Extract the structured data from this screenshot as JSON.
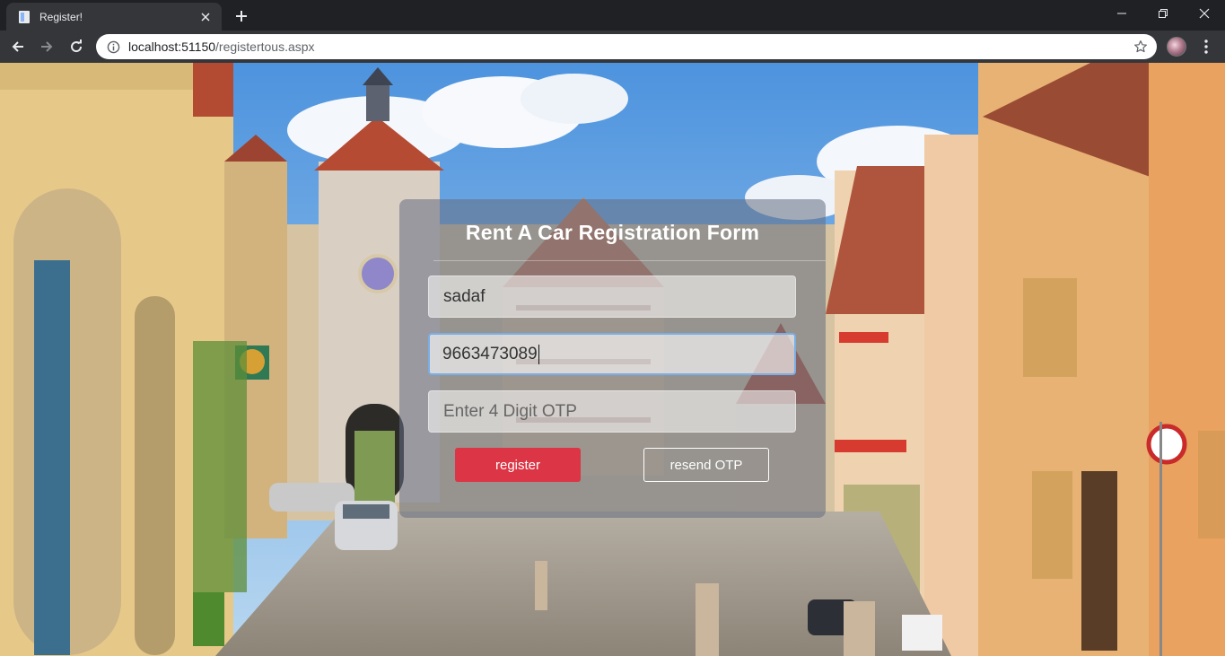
{
  "browser": {
    "tab_title": "Register!",
    "url_host": "localhost:51150",
    "url_path": "/registertous.aspx"
  },
  "form": {
    "title": "Rent A Car Registration Form",
    "name_value": "sadaf",
    "phone_value": "9663473089",
    "otp_placeholder": "Enter 4 Digit OTP",
    "register_label": "register",
    "resend_label": "resend OTP"
  },
  "colors": {
    "register_button": "#dc3545",
    "focus_border": "#7aaee6",
    "chrome_dark": "#202124",
    "chrome_toolbar": "#35363a"
  }
}
